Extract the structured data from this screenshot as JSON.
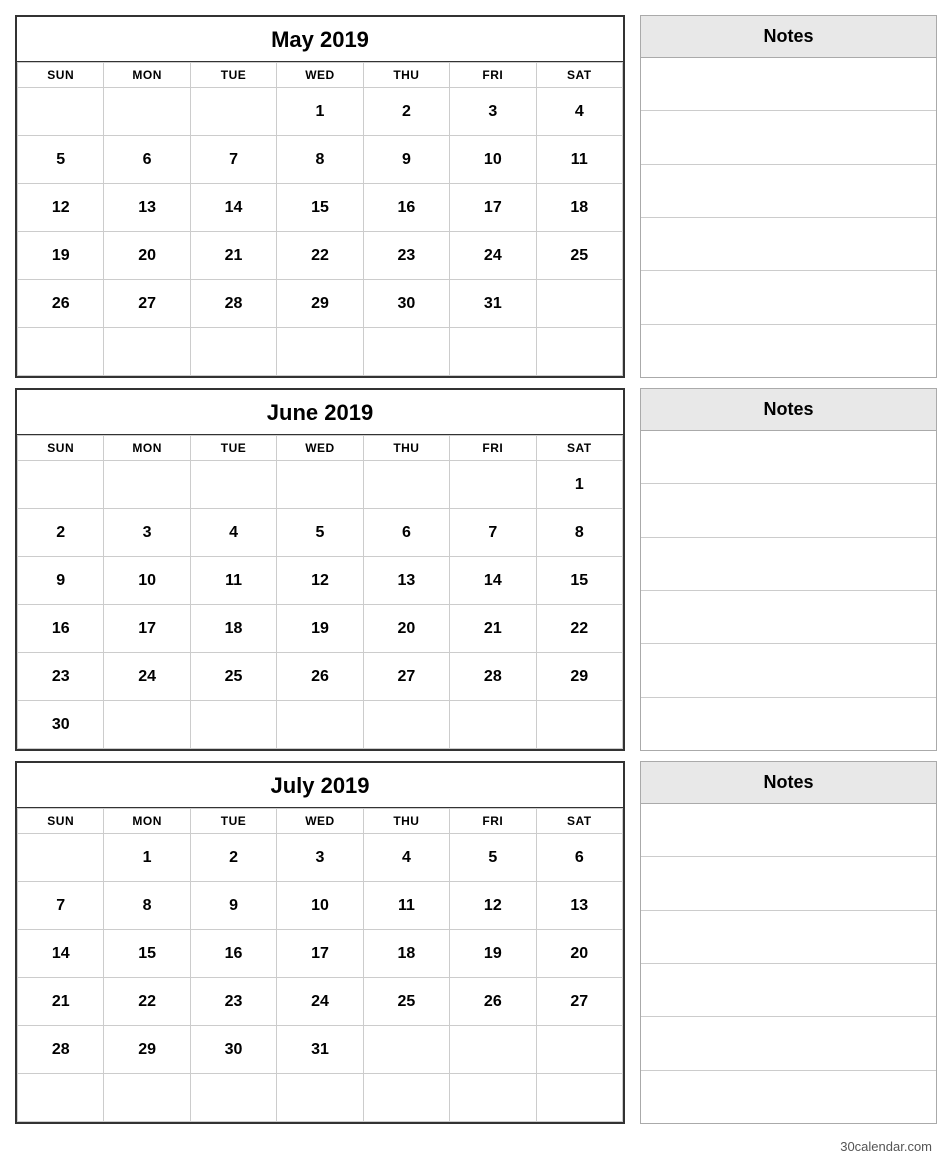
{
  "months": [
    {
      "title": "May 2019",
      "days_header": [
        "SUN",
        "MON",
        "TUE",
        "WED",
        "THU",
        "FRI",
        "SAT"
      ],
      "weeks": [
        [
          "",
          "",
          "",
          "1",
          "2",
          "3",
          "4"
        ],
        [
          "5",
          "6",
          "7",
          "8",
          "9",
          "10",
          "11"
        ],
        [
          "12",
          "13",
          "14",
          "15",
          "16",
          "17",
          "18"
        ],
        [
          "19",
          "20",
          "21",
          "22",
          "23",
          "24",
          "25"
        ],
        [
          "26",
          "27",
          "28",
          "29",
          "30",
          "31",
          ""
        ],
        [
          "",
          "",
          "",
          "",
          "",
          "",
          ""
        ]
      ],
      "notes_label": "Notes",
      "notes_lines": 6
    },
    {
      "title": "June 2019",
      "days_header": [
        "SUN",
        "MON",
        "TUE",
        "WED",
        "THU",
        "FRI",
        "SAT"
      ],
      "weeks": [
        [
          "",
          "",
          "",
          "",
          "",
          "",
          "1"
        ],
        [
          "2",
          "3",
          "4",
          "5",
          "6",
          "7",
          "8"
        ],
        [
          "9",
          "10",
          "11",
          "12",
          "13",
          "14",
          "15"
        ],
        [
          "16",
          "17",
          "18",
          "19",
          "20",
          "21",
          "22"
        ],
        [
          "23",
          "24",
          "25",
          "26",
          "27",
          "28",
          "29"
        ],
        [
          "30",
          "",
          "",
          "",
          "",
          "",
          ""
        ]
      ],
      "notes_label": "Notes",
      "notes_lines": 6
    },
    {
      "title": "July 2019",
      "days_header": [
        "SUN",
        "MON",
        "TUE",
        "WED",
        "THU",
        "FRI",
        "SAT"
      ],
      "weeks": [
        [
          "",
          "1",
          "2",
          "3",
          "4",
          "5",
          "6"
        ],
        [
          "7",
          "8",
          "9",
          "10",
          "11",
          "12",
          "13"
        ],
        [
          "14",
          "15",
          "16",
          "17",
          "18",
          "19",
          "20"
        ],
        [
          "21",
          "22",
          "23",
          "24",
          "25",
          "26",
          "27"
        ],
        [
          "28",
          "29",
          "30",
          "31",
          "",
          "",
          ""
        ],
        [
          "",
          "",
          "",
          "",
          "",
          "",
          ""
        ]
      ],
      "notes_label": "Notes",
      "notes_lines": 6
    }
  ],
  "footer": "30calendar.com"
}
